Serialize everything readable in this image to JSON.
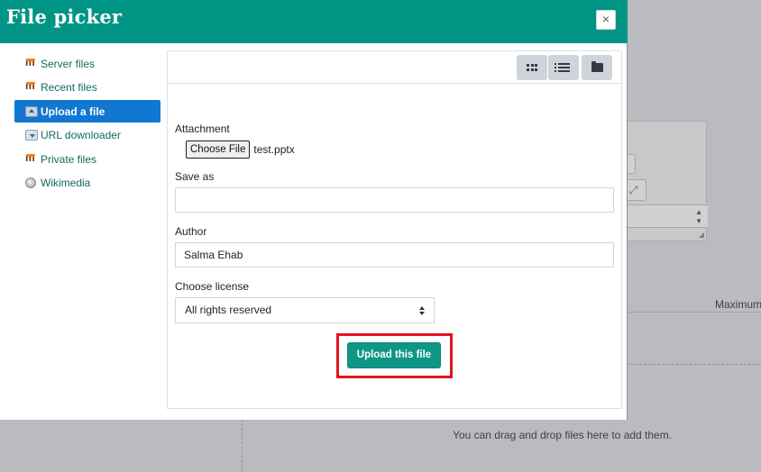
{
  "dialog": {
    "title": "File picker",
    "close_symbol": "×"
  },
  "sidebar": {
    "items": [
      {
        "label": "Server files",
        "icon": "moodle-icon"
      },
      {
        "label": "Recent files",
        "icon": "moodle-icon"
      },
      {
        "label": "Upload a file",
        "icon": "upload-icon",
        "active": true
      },
      {
        "label": "URL downloader",
        "icon": "url-download-icon"
      },
      {
        "label": "Private files",
        "icon": "moodle-icon"
      },
      {
        "label": "Wikimedia",
        "icon": "wikimedia-globe-icon"
      }
    ]
  },
  "toolbar": {
    "views": [
      "view-icons-icon",
      "view-list-icon",
      "view-tree-icon"
    ]
  },
  "form": {
    "attachment_label": "Attachment",
    "choose_file_label": "Choose File",
    "file_name": "test.pptx",
    "save_as_label": "Save as",
    "save_as_value": "",
    "author_label": "Author",
    "author_value": "Salma Ehab",
    "license_label": "Choose license",
    "license_selected": "All rights reserved",
    "submit_label": "Upload this file"
  },
  "background": {
    "maximum_text": "Maximum",
    "drag_drop_text": "You can drag and drop files here to add them."
  },
  "colors": {
    "header": "#009485",
    "active_item": "#1177d1",
    "link": "#0f6b64",
    "primary_button": "#0f9786",
    "highlight": "#e0131f"
  }
}
